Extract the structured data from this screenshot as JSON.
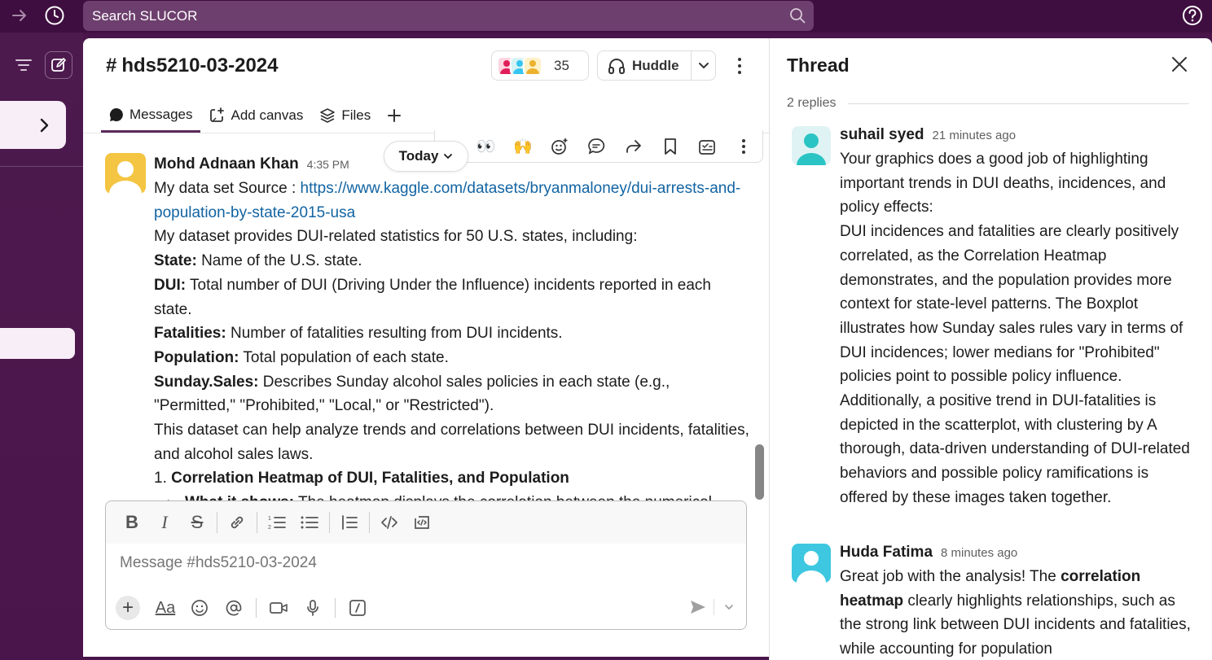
{
  "topbar": {
    "search_placeholder": "Search SLUCOR"
  },
  "channel": {
    "hash": "#",
    "name": "hds5210-03-2024",
    "member_count": "35",
    "huddle_label": "Huddle"
  },
  "tabs": [
    {
      "label": "Messages"
    },
    {
      "label": "Add canvas"
    },
    {
      "label": "Files"
    }
  ],
  "today_label": "Today",
  "hover_bar": {
    "emoji_eyes": "👀",
    "emoji_hands": "🙌"
  },
  "message": {
    "author": "Mohd Adnaan Khan",
    "time": "4:35 PM",
    "line1_prefix": "My data set Source : ",
    "link": "https://www.kaggle.com/datasets/bryanmaloney/dui-arrests-and-population-by-state-2015-usa",
    "line2": "My dataset provides DUI-related statistics for 50 U.S. states, including:",
    "state_label": "State:",
    "state_text": " Name of the U.S. state.",
    "dui_label": "DUI:",
    "dui_text": " Total number of DUI (Driving Under the Influence) incidents reported in each state.",
    "fatalities_label": "Fatalities:",
    "fatalities_text": " Number of fatalities resulting from DUI incidents.",
    "population_label": "Population:",
    "population_text": " Total population of each state.",
    "sunday_label": "Sunday.Sales:",
    "sunday_text": " Describes Sunday alcohol sales policies in each state (e.g., \"Permitted,\" \"Prohibited,\" \"Local,\" or \"Restricted\").",
    "summary": "This dataset can help analyze trends and correlations between DUI incidents, fatalities, and alcohol sales laws.",
    "heading_num": "1. ",
    "heading": "Correlation Heatmap of DUI, Fatalities, and Population",
    "bullet_label": "What it shows:",
    "bullet_text": " The heatmap displays the correlation between the numerical"
  },
  "composer": {
    "placeholder": "Message #hds5210-03-2024",
    "font_label": "Aa"
  },
  "thread": {
    "title": "Thread",
    "replies_count": "2 replies",
    "replies": [
      {
        "author": "suhail syed",
        "time": "21 minutes ago",
        "p1": "Your graphics does a good job of highlighting important trends in DUI deaths, incidences, and policy effects:",
        "p2": "DUI incidences and fatalities are clearly positively correlated, as the Correlation Heatmap demonstrates, and the population provides more context for state-level patterns. The Boxplot illustrates how Sunday sales rules vary in terms of DUI incidences; lower medians for \"Prohibited\" policies point to possible policy influence. Additionally, a positive trend in DUI-fatalities is depicted in the scatterplot, with clustering by A thorough, data-driven understanding of DUI-related behaviors and possible policy ramifications is offered by these images taken together."
      },
      {
        "author": "Huda Fatima",
        "time": "8 minutes ago",
        "t1": "Great job with the analysis! The ",
        "t2": "correlation heatmap",
        "t3": " clearly highlights relationships, such as the strong link between DUI incidents and fatalities, while accounting for population"
      }
    ]
  }
}
